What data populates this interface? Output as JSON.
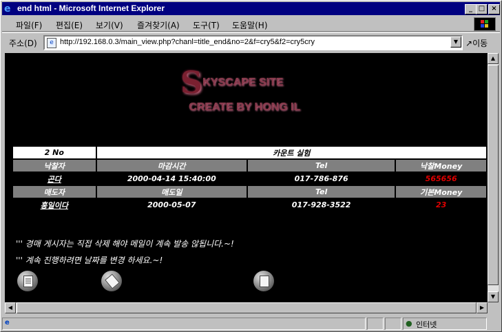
{
  "window": {
    "title": "end html - Microsoft Internet Explorer",
    "controls": {
      "minimize": "_",
      "maximize": "□",
      "close": "×"
    }
  },
  "menu": [
    "파일(F)",
    "편집(E)",
    "보기(V)",
    "즐겨찾기(A)",
    "도구(T)",
    "도움말(H)"
  ],
  "address": {
    "label": "주소(D)",
    "url": "http://192.168.0.3/main_view.php?chanl=title_end&no=2&f=cry5&f2=cry5cry",
    "go_label": "이동"
  },
  "logo": {
    "big_letter": "S",
    "line1": "KYSCAPE SITE",
    "line2": "CREATE BY HONG IL"
  },
  "auction": {
    "number": "2 No",
    "title": "카운트 실험",
    "row1_headers": [
      "낙찰자",
      "마감시간",
      "Tel",
      "낙찰Money"
    ],
    "row1_values": [
      "곤다",
      "2000-04-14 15:40:00",
      "017-786-876",
      "565656"
    ],
    "row2_headers": [
      "매도자",
      "매도일",
      "Tel",
      "기본Money"
    ],
    "row2_values": [
      "홍일이다",
      "2000-05-07",
      "017-928-3522",
      "23"
    ]
  },
  "notices": [
    "''' 경매 게시자는 직접 삭제 해야 메일이 계속 발송 않됩니다.~!",
    "''' 계속 진행하려면 날짜를 변경 하세요.~!"
  ],
  "actions": [
    "list-icon",
    "edit-icon",
    "delete-icon"
  ],
  "status": {
    "zone": "인터넷"
  },
  "colors": {
    "titlebar": "#000080",
    "price_red": "#e00000",
    "header_gray": "#808080"
  }
}
